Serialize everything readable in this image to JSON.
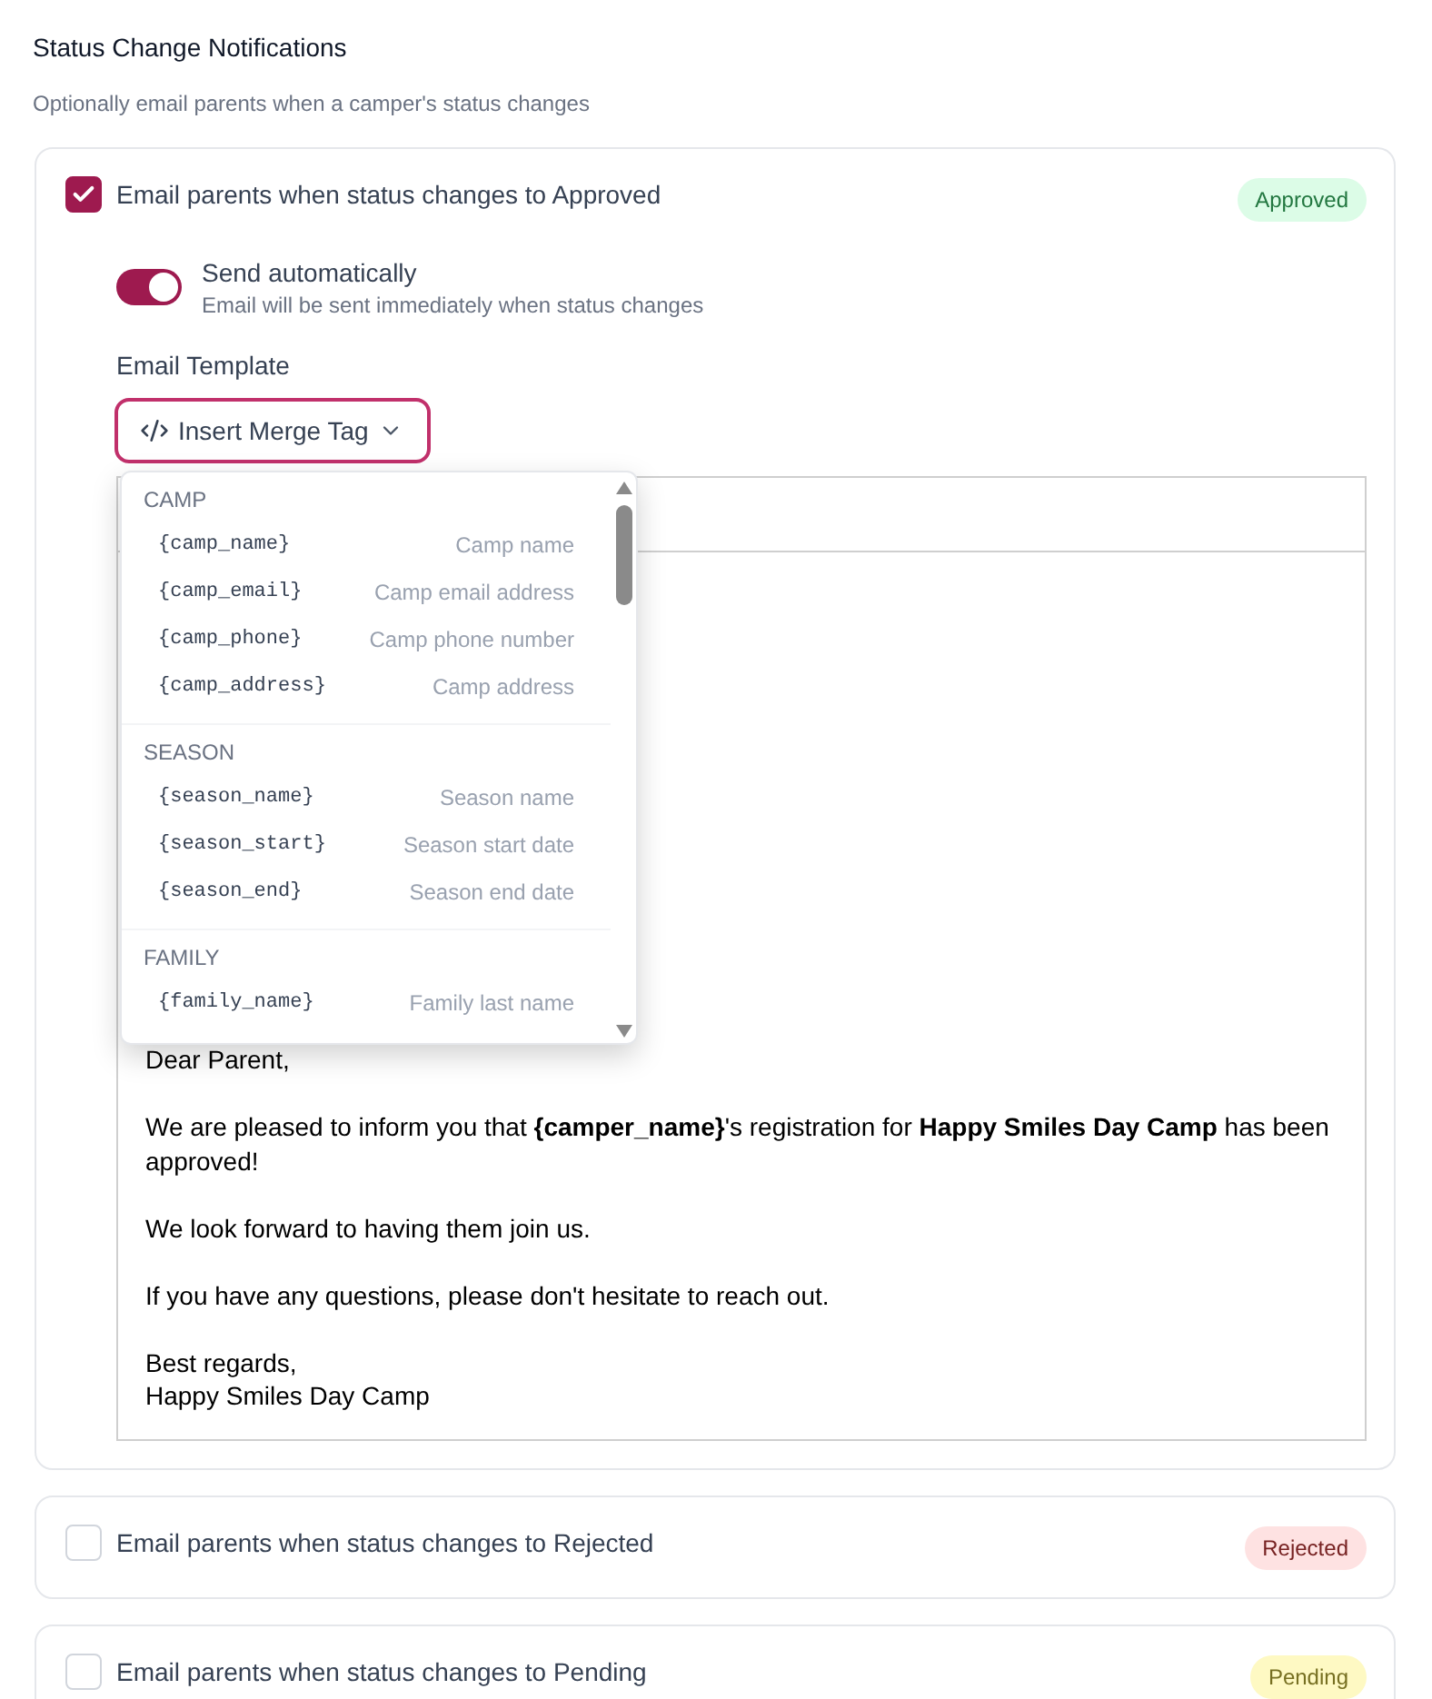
{
  "header": {
    "title": "Status Change Notifications",
    "subtitle": "Optionally email parents when a camper's status changes"
  },
  "notifications": [
    {
      "label": "Email parents when status changes to Approved",
      "checked": true,
      "badge": {
        "text": "Approved",
        "color": "#dcfce7"
      },
      "details": {
        "send_automatically": {
          "label": "Send automatically",
          "description": "Email will be sent immediately when status changes",
          "on": true
        },
        "template_label": "Email Template",
        "merge_tag_button": {
          "label": "Insert Merge Tag",
          "expanded": true
        },
        "merge_tag_menu": {
          "groups": [
            {
              "heading": "CAMP",
              "items": [
                {
                  "tag": "{camp_name}",
                  "description": "Camp name"
                },
                {
                  "tag": "{camp_email}",
                  "description": "Camp email address"
                },
                {
                  "tag": "{camp_phone}",
                  "description": "Camp phone number"
                },
                {
                  "tag": "{camp_address}",
                  "description": "Camp address"
                }
              ]
            },
            {
              "heading": "SEASON",
              "items": [
                {
                  "tag": "{season_name}",
                  "description": "Season name"
                },
                {
                  "tag": "{season_start}",
                  "description": "Season start date"
                },
                {
                  "tag": "{season_end}",
                  "description": "Season end date"
                }
              ]
            },
            {
              "heading": "FAMILY",
              "items": [
                {
                  "tag": "{family_name}",
                  "description": "Family last name"
                }
              ]
            }
          ]
        },
        "email_body": {
          "paragraphs": [
            "Dear Parent,",
            "We are pleased to inform you that **{camper_name}**'s registration for **Happy Smiles Day Camp** has been approved!",
            "We look forward to having them join us.",
            "If you have any questions, please don't hesitate to reach out.",
            "Best regards,\nHappy Smiles Day Camp"
          ]
        }
      }
    },
    {
      "label": "Email parents when status changes to Rejected",
      "checked": false,
      "badge": {
        "text": "Rejected",
        "color": "#fee2e2"
      }
    },
    {
      "label": "Email parents when status changes to Pending",
      "checked": false,
      "badge": {
        "text": "Pending",
        "color": "#fef9c3"
      }
    }
  ]
}
